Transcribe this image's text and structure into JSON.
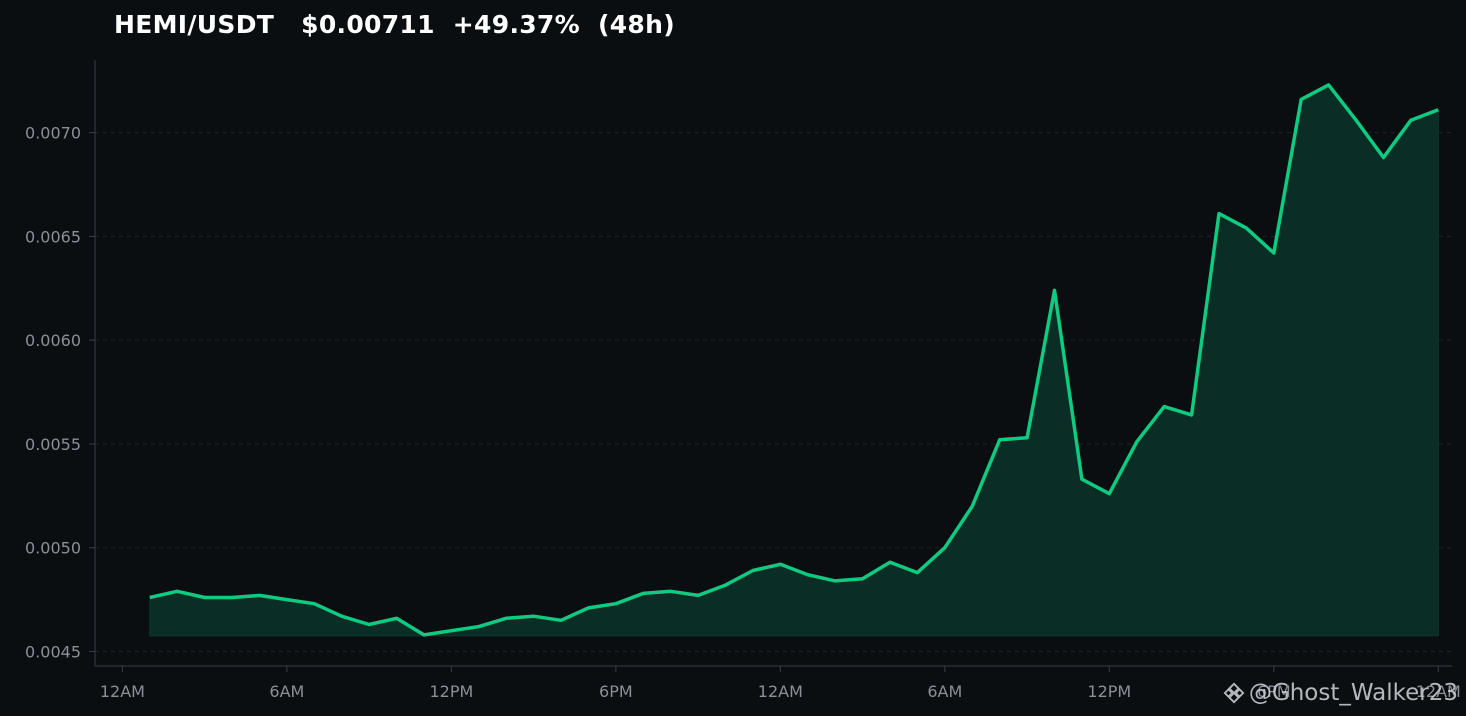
{
  "chart_data": {
    "type": "area",
    "title": "HEMI/USDT   $0.00711  +49.37%  (48h)",
    "x_tick_labels": [
      "12AM",
      "6AM",
      "12PM",
      "6PM",
      "12AM",
      "6AM",
      "12PM",
      "6PM",
      "12AM"
    ],
    "y_tick_labels": [
      "0.0045",
      "0.0050",
      "0.0055",
      "0.0060",
      "0.0065",
      "0.0070"
    ],
    "y_ticks": [
      0.0045,
      0.005,
      0.0055,
      0.006,
      0.0065,
      0.007
    ],
    "ylim": [
      0.00443,
      0.00735
    ],
    "x_start_hour": 1,
    "x_step_hours": 1,
    "xlim_hours": [
      -1,
      48.5
    ],
    "baseline": 0.004575,
    "values": [
      0.00476,
      0.00479,
      0.00476,
      0.00476,
      0.00477,
      0.00475,
      0.00473,
      0.00467,
      0.00463,
      0.00466,
      0.00458,
      0.0046,
      0.00462,
      0.00466,
      0.00467,
      0.00465,
      0.00471,
      0.00473,
      0.00478,
      0.00479,
      0.00477,
      0.00482,
      0.00489,
      0.00492,
      0.00487,
      0.00484,
      0.00485,
      0.00493,
      0.00488,
      0.005,
      0.0052,
      0.00552,
      0.00553,
      0.00624,
      0.00533,
      0.00526,
      0.00551,
      0.00568,
      0.00564,
      0.00661,
      0.00654,
      0.00642,
      0.00716,
      0.00723,
      0.00706,
      0.00688,
      0.00706,
      0.00711
    ],
    "grid": true,
    "line_color": "#0ecb81",
    "fill_color": "#0a2e25",
    "axis_text_color": "#8a8f98"
  },
  "watermark": {
    "text": "@Ghost_Walker23",
    "icon": "binance-icon"
  }
}
